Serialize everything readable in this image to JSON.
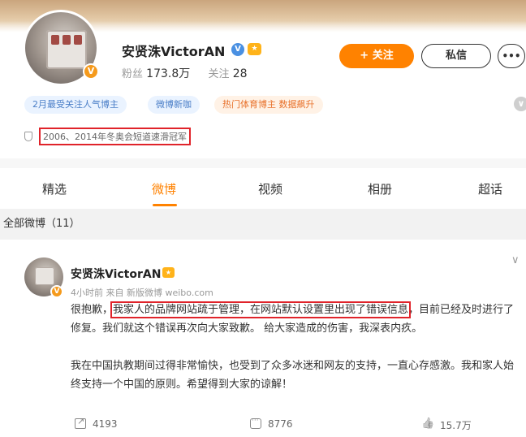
{
  "profile": {
    "name": "安贤洙VictorAN",
    "verified_icon": "V",
    "level_icon": "😍",
    "avatar_badge": "V",
    "followers_label": "粉丝",
    "followers_value": "173.8万",
    "following_label": "关注",
    "following_value": "28"
  },
  "actions": {
    "follow_label": "+ 关注",
    "message_label": "私信",
    "more_label": "•••"
  },
  "tags": [
    {
      "label": "2月最受关注人气博主"
    },
    {
      "label": "微博新咖"
    },
    {
      "label": "热门体育博主 数据飙升"
    }
  ],
  "honor": "2006、2014年冬奥会短道速滑冠军",
  "tabs": [
    {
      "label": "精选"
    },
    {
      "label": "微博",
      "active": true
    },
    {
      "label": "视频"
    },
    {
      "label": "相册"
    },
    {
      "label": "超话"
    }
  ],
  "feed_header": "全部微博（11）",
  "post": {
    "author": "安贤洙VictorAN",
    "level_icon": "😍",
    "meta": "4小时前 来自 新版微博 weibo.com",
    "chevron": "∨",
    "para1_pre": "很抱歉，",
    "para1_highlight": "我家人的品牌网站疏于管理，在网站默认设置里出现了错误信息",
    "para1_post": "，目前已经及时进行了修复。我们就这个错误再次向大家致歉。 给大家造成的伤害，我深表内疚。",
    "para2": "我在中国执教期间过得非常愉快，也受到了众多冰迷和网友的支持，一直心存感激。我和家人始终支持一个中国的原则。希望得到大家的谅解！",
    "forward_count": "4193",
    "comment_count": "8776",
    "like_count": "15.7万"
  },
  "colors": {
    "accent": "#ff8200",
    "highlight_box": "#e0232a",
    "tag_blue": "#4a7ec7",
    "tag_orange": "#e8722c"
  }
}
